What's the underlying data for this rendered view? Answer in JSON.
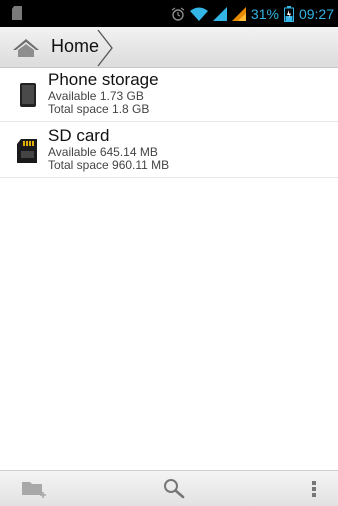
{
  "status_bar": {
    "battery_percent": "31%",
    "time": "09:27",
    "icons": [
      "sd-card-icon",
      "alarm-icon",
      "wifi-icon",
      "signal-icon",
      "signal-icon",
      "battery-icon"
    ],
    "accent": "#33b5e5"
  },
  "breadcrumb": {
    "home_label": "Home",
    "icon": "home-icon"
  },
  "storage": {
    "items": [
      {
        "title": "Phone storage",
        "available": "Available 1.73 GB",
        "total": "Total space 1.8 GB",
        "icon": "phone-storage-icon"
      },
      {
        "title": "SD card",
        "available": "Available 645.14 MB",
        "total": "Total space 960.11 MB",
        "icon": "sd-card-icon"
      }
    ]
  },
  "bottom_bar": {
    "buttons": [
      "new-folder-icon",
      "search-icon",
      "overflow-menu-icon"
    ]
  }
}
